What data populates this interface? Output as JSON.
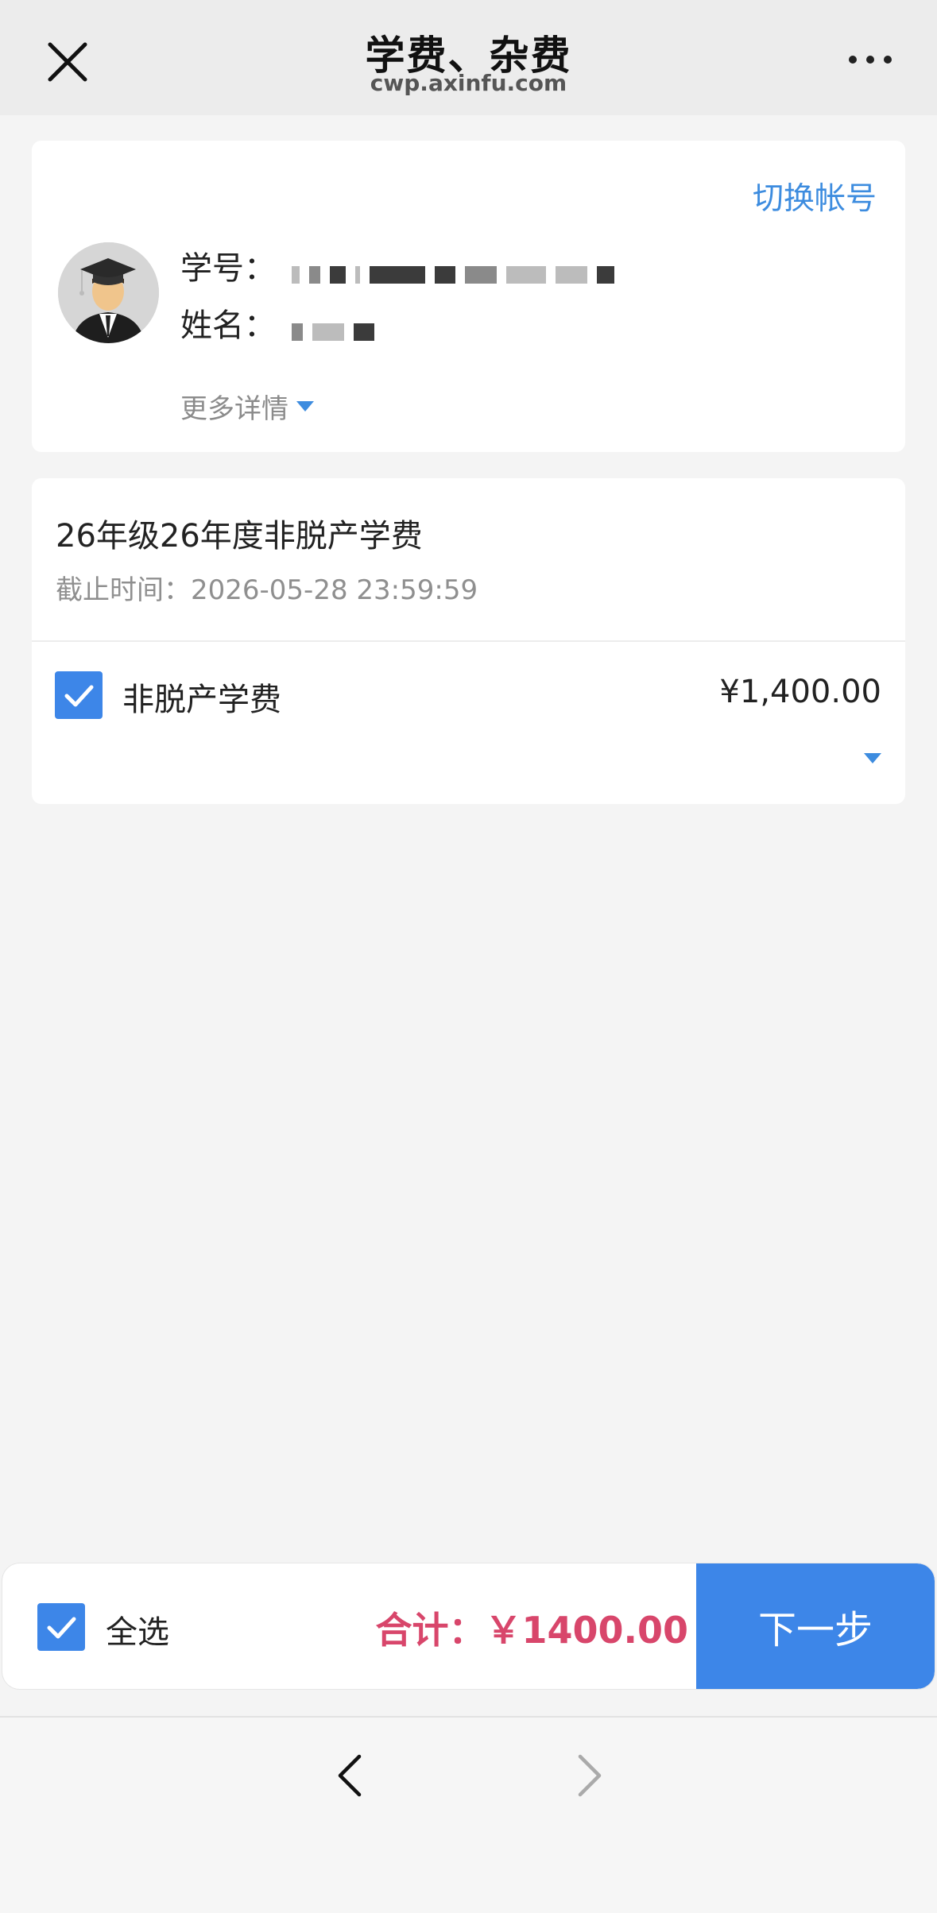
{
  "nav": {
    "title": "学费、杂费",
    "url": "cwp.axinfu.com"
  },
  "account": {
    "switch_label": "切换帐号",
    "student_id_label": "学号：",
    "name_label": "姓名：",
    "more_details": "更多详情"
  },
  "fee": {
    "title": "26年级26年度非脱产学费",
    "deadline": "截止时间：2026-05-28 23:59:59",
    "item": {
      "label": "非脱产学费",
      "amount": "¥1,400.00",
      "checked": true
    }
  },
  "checkout": {
    "select_all": "全选",
    "total": "合计：￥1400.00",
    "next": "下一步"
  },
  "colors": {
    "accent": "#3d86e8",
    "link": "#3d8cdf",
    "total": "#d8466b"
  }
}
